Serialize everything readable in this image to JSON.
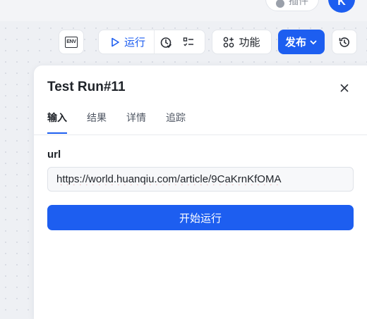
{
  "header": {
    "pill_label": "插件",
    "avatar_initial": "K"
  },
  "toolbar": {
    "env_label": "ENV",
    "run_label": "运行",
    "feature_label": "功能",
    "publish_label": "发布"
  },
  "panel": {
    "title": "Test Run#11",
    "tabs": [
      {
        "label": "输入",
        "active": true
      },
      {
        "label": "结果",
        "active": false
      },
      {
        "label": "详情",
        "active": false
      },
      {
        "label": "追踪",
        "active": false
      }
    ],
    "field_label": "url",
    "url_value": "https://world.huanqiu.com/article/9CaKrnKfOMA",
    "start_button_label": "开始运行"
  },
  "colors": {
    "accent": "#1d5ef0",
    "canvas_bg": "#eef0f4",
    "spellcheck_underline": "#e23b3b"
  }
}
